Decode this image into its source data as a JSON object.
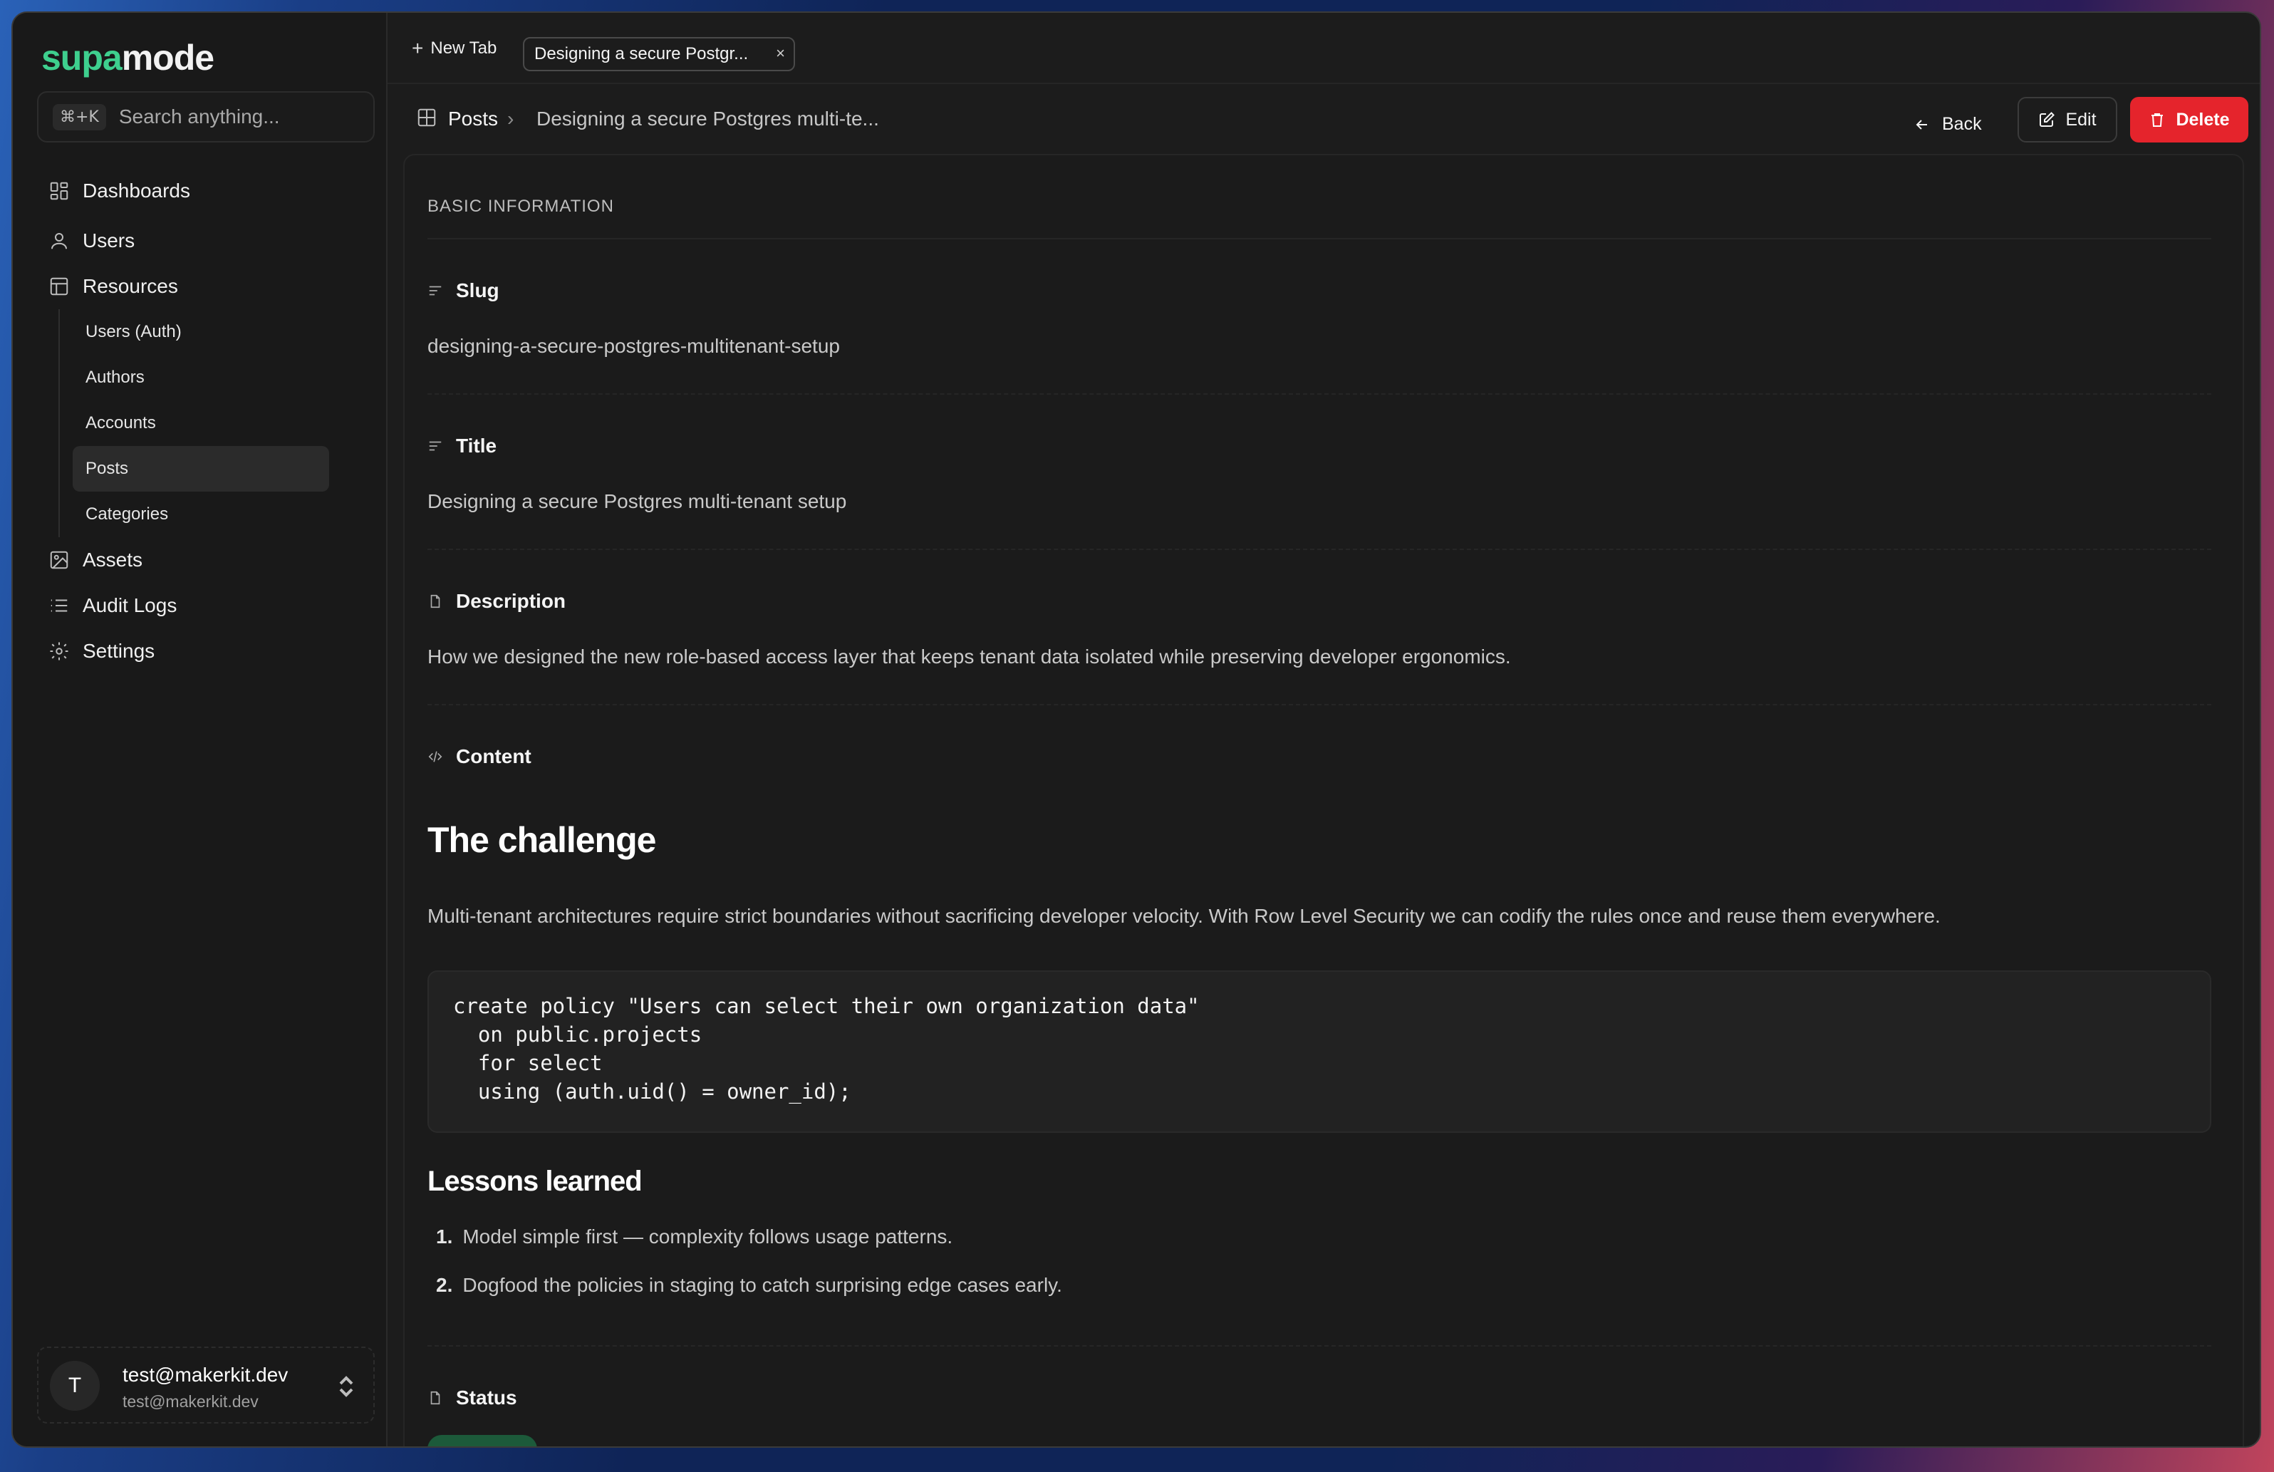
{
  "app": {
    "logo_part1": "supa",
    "logo_part2": "mode"
  },
  "search": {
    "shortcut": "⌘+K",
    "placeholder": "Search anything..."
  },
  "sidebar": {
    "items": [
      {
        "label": "Dashboards",
        "icon": "dashboard-icon"
      },
      {
        "label": "Users",
        "icon": "user-icon"
      },
      {
        "label": "Resources",
        "icon": "table-icon"
      },
      {
        "label": "Assets",
        "icon": "image-icon"
      },
      {
        "label": "Audit Logs",
        "icon": "list-icon"
      },
      {
        "label": "Settings",
        "icon": "gear-icon"
      }
    ],
    "resources": [
      {
        "label": "Users (Auth)"
      },
      {
        "label": "Authors"
      },
      {
        "label": "Accounts"
      },
      {
        "label": "Posts",
        "active": true
      },
      {
        "label": "Categories"
      }
    ]
  },
  "user": {
    "initial": "T",
    "name": "test@makerkit.dev",
    "email": "test@makerkit.dev"
  },
  "tabs": {
    "new_tab_label": "New Tab",
    "active_tab": "Designing a secure Postgr...",
    "close": "×"
  },
  "breadcrumb": {
    "parent": "Posts",
    "separator": "›",
    "current": "Designing a secure Postgres multi-te..."
  },
  "actions": {
    "back": "Back",
    "edit": "Edit",
    "delete": "Delete"
  },
  "record": {
    "section_title": "BASIC INFORMATION",
    "slug_label": "Slug",
    "slug_value": "designing-a-secure-postgres-multitenant-setup",
    "title_label": "Title",
    "title_value": "Designing a secure Postgres multi-tenant setup",
    "description_label": "Description",
    "description_value": "How we designed the new role-based access layer that keeps tenant data isolated while preserving developer ergonomics.",
    "content_label": "Content",
    "content": {
      "heading1": "The challenge",
      "paragraph": "Multi-tenant architectures require strict boundaries without sacrificing developer velocity. With Row Level Security we can codify the rules once and reuse them everywhere.",
      "code": "create policy \"Users can select their own organization data\"\n  on public.projects\n  for select\n  using (auth.uid() = owner_id);",
      "heading2": "Lessons learned",
      "list": [
        {
          "num": "1.",
          "text": "Model simple first — complexity follows usage patterns."
        },
        {
          "num": "2.",
          "text": "Dogfood the policies in staging to catch surprising edge cases early."
        }
      ]
    },
    "status_label": "Status"
  },
  "colors": {
    "accent": "#3ecf8e",
    "danger": "#e5242c",
    "background": "#1c1c1c"
  }
}
